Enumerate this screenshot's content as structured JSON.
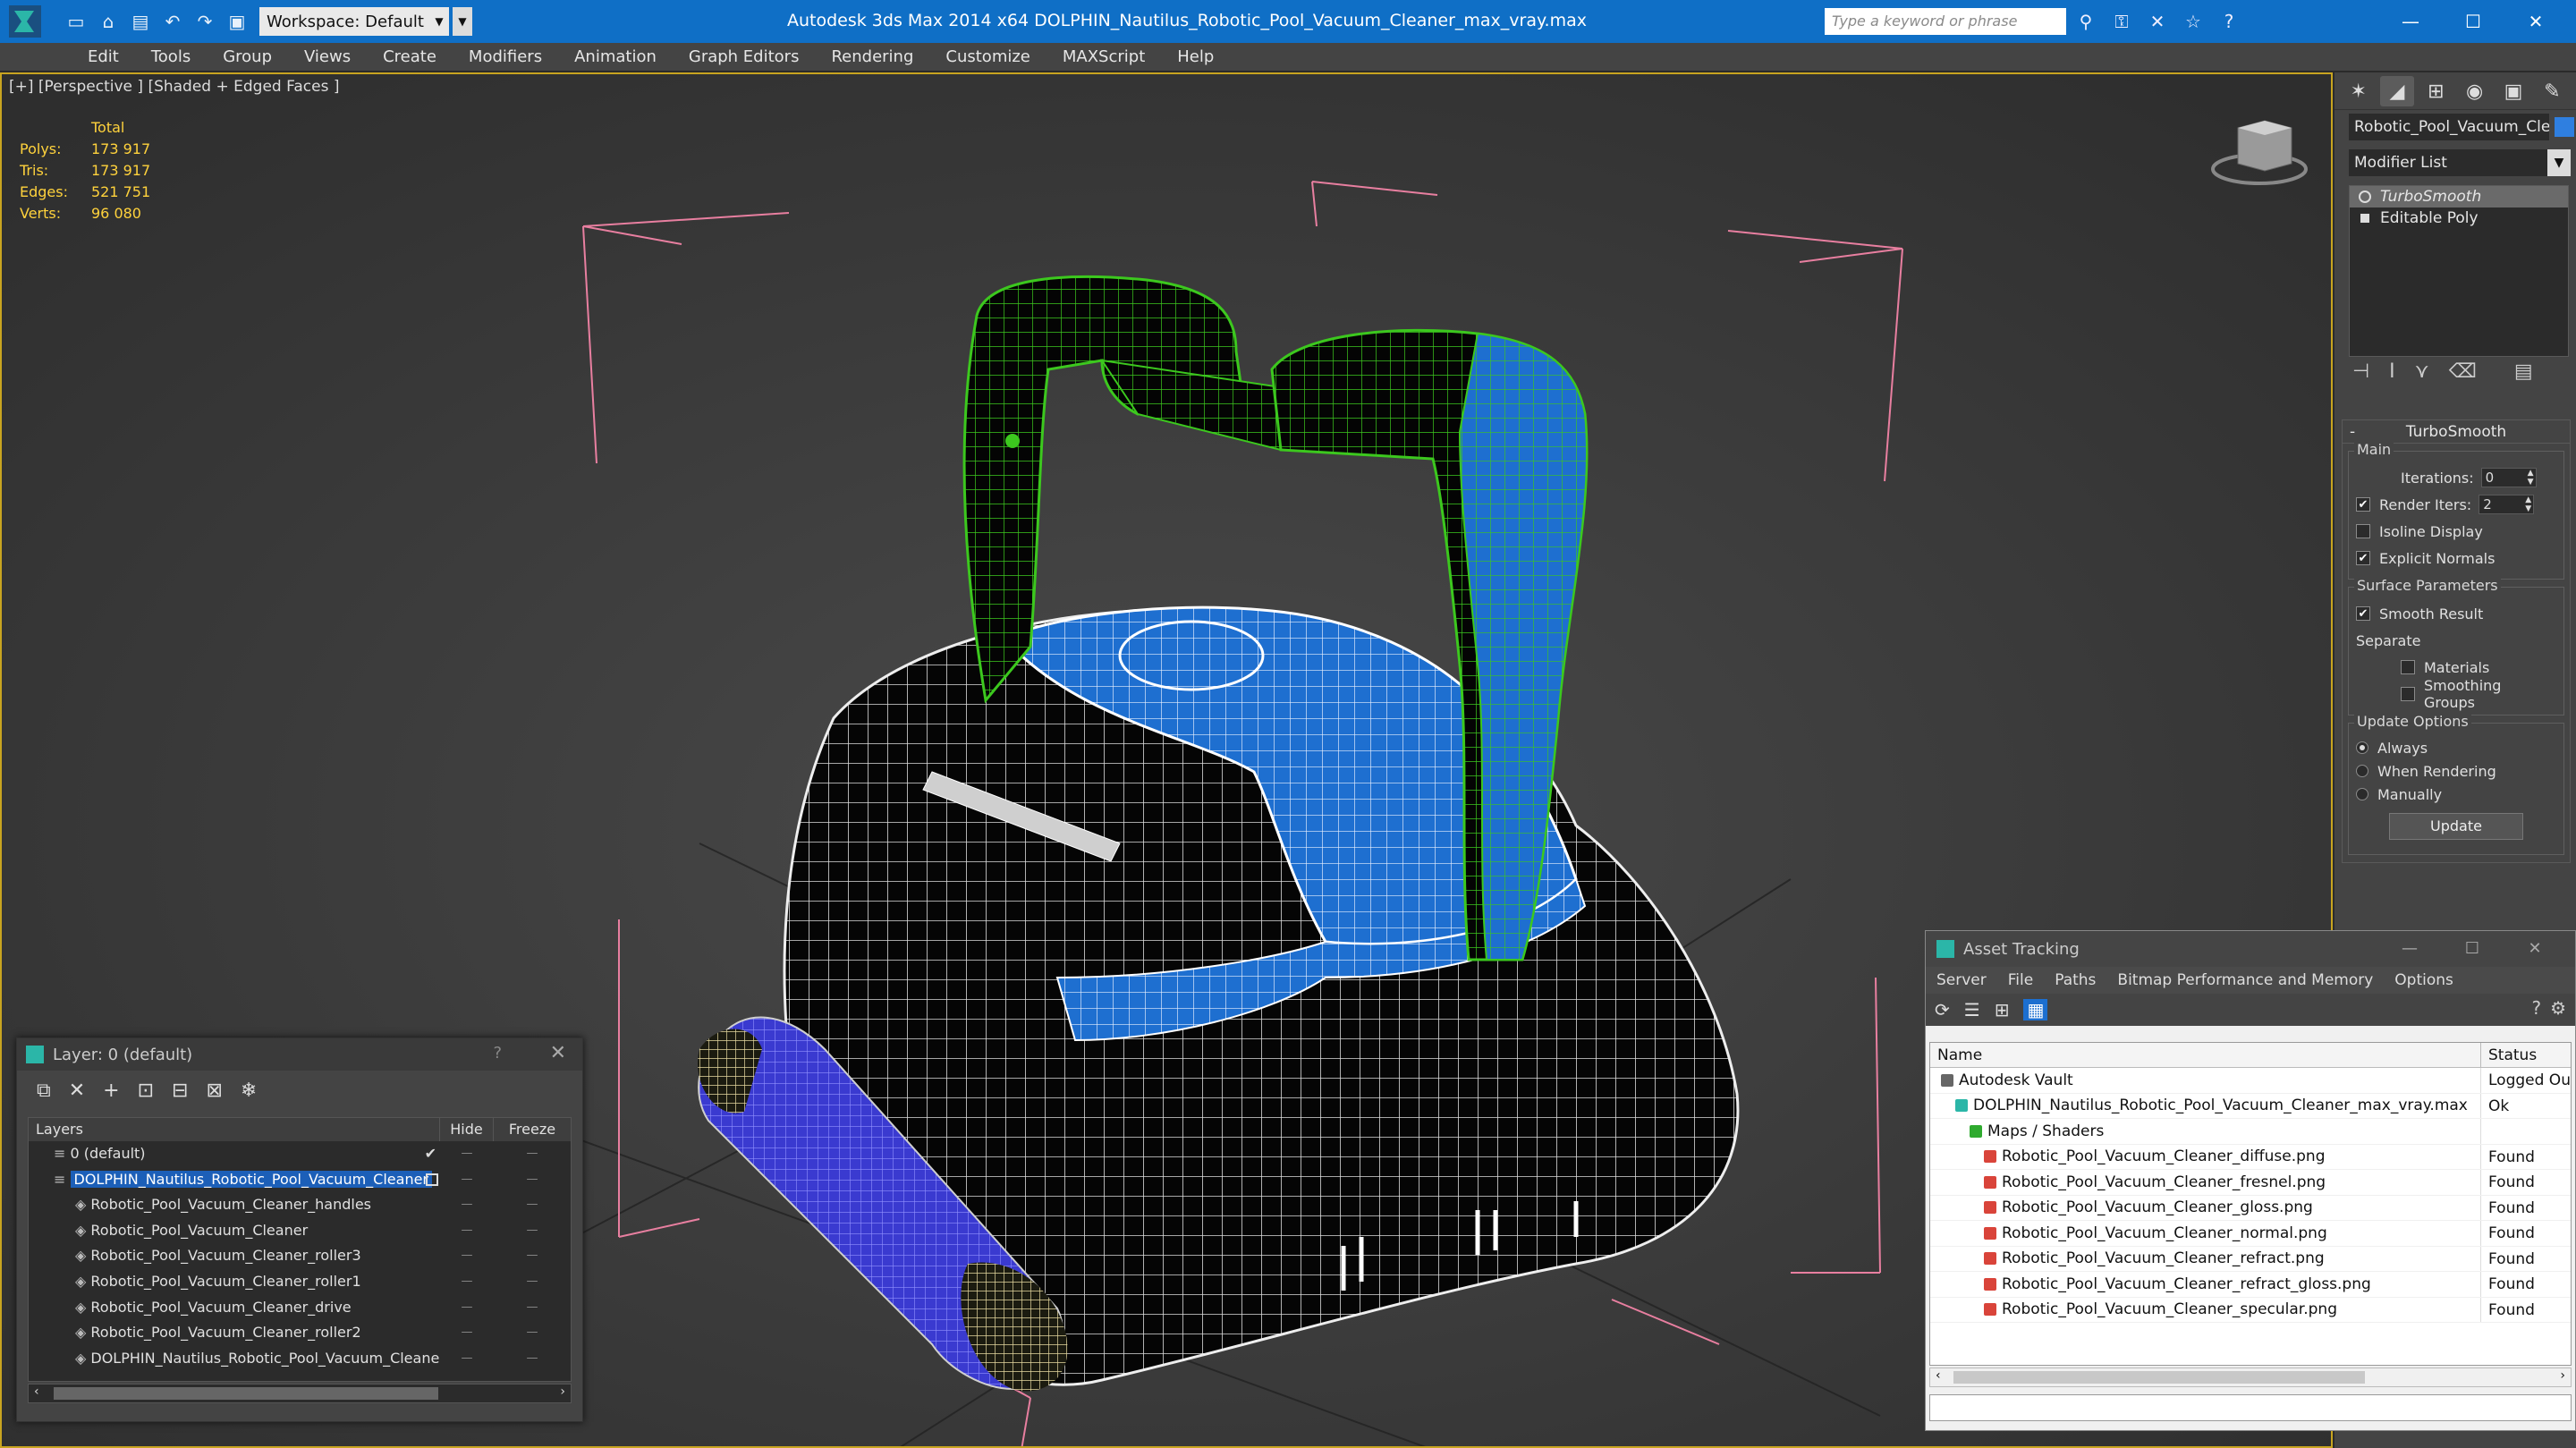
{
  "window": {
    "title": "Autodesk 3ds Max  2014 x64     DOLPHIN_Nautilus_Robotic_Pool_Vacuum_Cleaner_max_vray.max",
    "workspace": "Workspace: Default",
    "search_placeholder": "Type a keyword or phrase"
  },
  "menu": [
    "Edit",
    "Tools",
    "Group",
    "Views",
    "Create",
    "Modifiers",
    "Animation",
    "Graph Editors",
    "Rendering",
    "Customize",
    "MAXScript",
    "Help"
  ],
  "viewport": {
    "label": "[+] [Perspective ] [Shaded + Edged Faces ]",
    "stats": {
      "header": "Total",
      "rows": [
        {
          "k": "Polys:",
          "v": "173 917"
        },
        {
          "k": "Tris:",
          "v": "173 917"
        },
        {
          "k": "Edges:",
          "v": "521 751"
        },
        {
          "k": "Verts:",
          "v": "96 080"
        }
      ]
    }
  },
  "command_panel": {
    "object_name": "Robotic_Pool_Vacuum_Cleaner",
    "object_color": "#2f7fe0",
    "modifier_list": "Modifier List",
    "stack": [
      "TurboSmooth",
      "Editable Poly"
    ],
    "rollout_title": "TurboSmooth",
    "main_label": "Main",
    "iterations_label": "Iterations:",
    "iterations_value": "0",
    "render_iters_label": "Render Iters:",
    "render_iters_value": "2",
    "isoline": "Isoline Display",
    "explicit_normals": "Explicit Normals",
    "surface_params": "Surface Parameters",
    "smooth_result": "Smooth Result",
    "separate": "Separate",
    "materials": "Materials",
    "smoothing_groups": "Smoothing Groups",
    "update_options": "Update Options",
    "always": "Always",
    "when_rendering": "When Rendering",
    "manually": "Manually",
    "update_button": "Update"
  },
  "layer_window": {
    "title": "Layer: 0 (default)",
    "help": "?",
    "columns": [
      "Layers",
      "Hide",
      "Freeze"
    ],
    "rows": [
      {
        "name": "0 (default)",
        "indent": 1,
        "icon": "layer",
        "check": true
      },
      {
        "name": "DOLPHIN_Nautilus_Robotic_Pool_Vacuum_Cleaner",
        "indent": 1,
        "icon": "layer",
        "selected": true
      },
      {
        "name": "Robotic_Pool_Vacuum_Cleaner_handles",
        "indent": 2,
        "icon": "object"
      },
      {
        "name": "Robotic_Pool_Vacuum_Cleaner",
        "indent": 2,
        "icon": "object"
      },
      {
        "name": "Robotic_Pool_Vacuum_Cleaner_roller3",
        "indent": 2,
        "icon": "object"
      },
      {
        "name": "Robotic_Pool_Vacuum_Cleaner_roller1",
        "indent": 2,
        "icon": "object"
      },
      {
        "name": "Robotic_Pool_Vacuum_Cleaner_drive",
        "indent": 2,
        "icon": "object"
      },
      {
        "name": "Robotic_Pool_Vacuum_Cleaner_roller2",
        "indent": 2,
        "icon": "object"
      },
      {
        "name": "DOLPHIN_Nautilus_Robotic_Pool_Vacuum_Cleaner",
        "indent": 2,
        "icon": "object"
      }
    ]
  },
  "asset_tracking": {
    "title": "Asset Tracking",
    "menu": [
      "Server",
      "File",
      "Paths",
      "Bitmap Performance and Memory",
      "Options"
    ],
    "columns": [
      "Name",
      "Status"
    ],
    "rows": [
      {
        "name": "Autodesk Vault",
        "status": "Logged Ou",
        "indent": 1,
        "icon": "vault"
      },
      {
        "name": "DOLPHIN_Nautilus_Robotic_Pool_Vacuum_Cleaner_max_vray.max",
        "status": "Ok",
        "indent": 2,
        "icon": "max"
      },
      {
        "name": "Maps / Shaders",
        "status": "",
        "indent": 3,
        "icon": "maps"
      },
      {
        "name": "Robotic_Pool_Vacuum_Cleaner_diffuse.png",
        "status": "Found",
        "indent": 4,
        "icon": "png"
      },
      {
        "name": "Robotic_Pool_Vacuum_Cleaner_fresnel.png",
        "status": "Found",
        "indent": 4,
        "icon": "png"
      },
      {
        "name": "Robotic_Pool_Vacuum_Cleaner_gloss.png",
        "status": "Found",
        "indent": 4,
        "icon": "png"
      },
      {
        "name": "Robotic_Pool_Vacuum_Cleaner_normal.png",
        "status": "Found",
        "indent": 4,
        "icon": "png"
      },
      {
        "name": "Robotic_Pool_Vacuum_Cleaner_refract.png",
        "status": "Found",
        "indent": 4,
        "icon": "png"
      },
      {
        "name": "Robotic_Pool_Vacuum_Cleaner_refract_gloss.png",
        "status": "Found",
        "indent": 4,
        "icon": "png"
      },
      {
        "name": "Robotic_Pool_Vacuum_Cleaner_specular.png",
        "status": "Found",
        "indent": 4,
        "icon": "png"
      }
    ]
  },
  "colors": {
    "title_bar": "#0f6fc6",
    "viewport_border": "#c8a420",
    "stats_text": "#ffd23c",
    "selection": "#1c5fb8",
    "model_blue": "#1e6fd0",
    "handle_green": "#3cc81e",
    "roller_blue": "#3a3ad0"
  }
}
